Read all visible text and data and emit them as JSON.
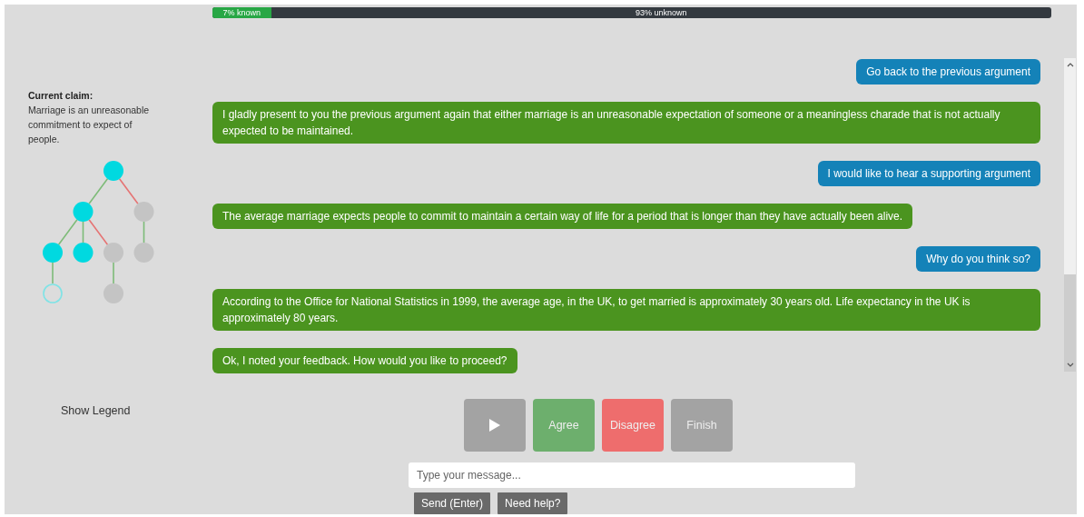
{
  "progress": {
    "known_label": "7% known",
    "unknown_label": "93% unknown",
    "level": 0.07
  },
  "claim": {
    "heading": "Current claim:",
    "text": "Marriage is an unreasonable commitment to expect of people."
  },
  "tree": {
    "known": true,
    "visited": true,
    "children": [
      {
        "attack": false,
        "known": true,
        "visited": true,
        "children": [
          {
            "attack": false,
            "known": true,
            "visited": true,
            "children": [
              {
                "attack": false,
                "known": true,
                "visited": false
              }
            ]
          },
          {
            "attack": false,
            "known": true,
            "visited": true
          },
          {
            "attack": true,
            "known": false,
            "visited": true,
            "children": [
              {
                "attack": false,
                "known": false,
                "visited": true
              }
            ]
          }
        ]
      },
      {
        "attack": true,
        "known": false,
        "visited": true,
        "children": [
          {
            "attack": false,
            "known": false,
            "visited": true
          }
        ]
      }
    ]
  },
  "legend_link": "Show Legend",
  "messages": [
    {
      "kind": "user",
      "text": "Go back to the previous argument"
    },
    {
      "kind": "bot",
      "text": "I gladly present to you the previous argument again that either marriage is an unreasonable expectation of someone or a meaningless charade that is not actually expected to be maintained."
    },
    {
      "kind": "user",
      "text": "I would like to hear a supporting argument"
    },
    {
      "kind": "bot",
      "text": "The average marriage expects people to commit to maintain a certain way of life for a period that is longer than they have actually been alive."
    },
    {
      "kind": "user",
      "text": "Why do you think so?"
    },
    {
      "kind": "bot",
      "text": "According to the Office for National Statistics in 1999, the average age, in the UK, to get married is approximately 30 years old. Life expectancy in the UK is approximately 80 years."
    },
    {
      "kind": "bot",
      "text": "Ok, I noted your feedback. How would you like to proceed?"
    }
  ],
  "controls": [
    {
      "kind": "play"
    },
    {
      "kind": "agree",
      "label": "Agree"
    },
    {
      "kind": "disagree",
      "label": "Disagree"
    },
    {
      "kind": "finish",
      "label": "Finish"
    }
  ],
  "input": {
    "placeholder": "Type your message..."
  },
  "buttons": [
    "Send (Enter)",
    "Need help?"
  ]
}
